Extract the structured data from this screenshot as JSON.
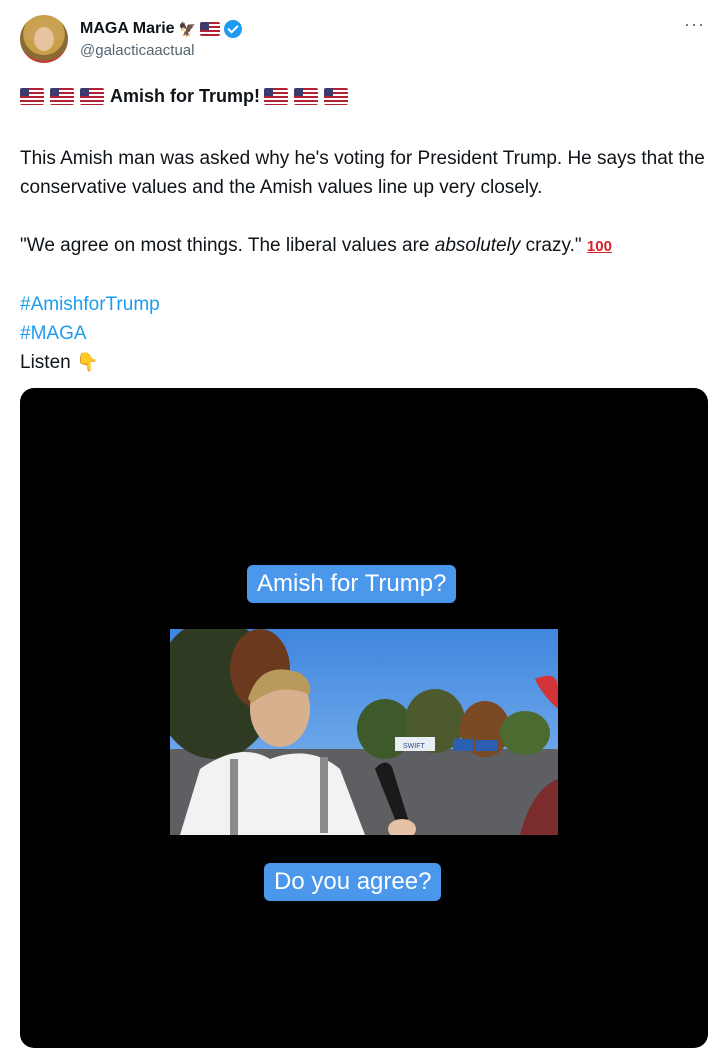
{
  "author": {
    "name": "MAGA Marie",
    "handle": "@galacticaactual",
    "verified": true,
    "name_emojis": [
      "eagle-icon",
      "us-flag-icon"
    ]
  },
  "tweet": {
    "title": "Amish for Trump!",
    "paragraph1": "This Amish man was asked why he's voting for President Trump. He says that the conservative values and the Amish values line up very closely.",
    "quote_part1": "\"We agree on most things. The liberal values are ",
    "quote_italic": "absolutely",
    "quote_part2": " crazy.\"",
    "quote_emoji": "100",
    "hashtags": [
      "#AmishforTrump",
      "#MAGA"
    ],
    "listen": "Listen"
  },
  "video": {
    "caption_top": "Amish for Trump?",
    "caption_bottom": "Do you agree?",
    "truck_text": "SWIFT"
  },
  "colors": {
    "hashtag": "#1d9bf0",
    "caption_bg": "#4a97ec",
    "verified": "#1d9bf0"
  }
}
